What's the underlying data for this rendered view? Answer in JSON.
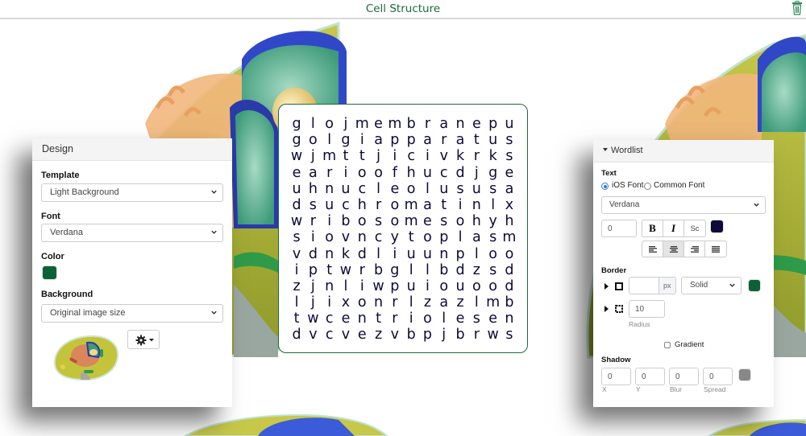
{
  "header": {
    "title": "Cell Structure",
    "trash_icon": "trash-icon",
    "title_color": "#1b6b3a"
  },
  "word_grid": {
    "rows": [
      "glojmembranepu",
      "golgiapparatus",
      "wjmttjicivkrks",
      "earioofhucdjge",
      "uhnucleolususa",
      "dsuchromatinlx",
      "wribosomesohyh",
      "siovncytoplasm",
      "vdnkdliuunploo",
      "iptwrbgllbdzsd",
      "zjnliwpuiouood",
      "ljixonrlzazlmb",
      "twcentriolesen",
      "dvcvezvbpjbrws"
    ],
    "letter_color": "#0c0a3a",
    "border_color": "#1b6b3a"
  },
  "design_panel": {
    "title": "Design",
    "template_label": "Template",
    "template_value": "Light Background",
    "font_label": "Font",
    "font_value": "Verdana",
    "color_label": "Color",
    "color_value": "#0b6236",
    "background_label": "Background",
    "background_value": "Original image size",
    "settings_icon": "gear-icon"
  },
  "wordlist_panel": {
    "title": "Wordlist",
    "text_label": "Text",
    "font_option_ios": "iOS Font",
    "font_option_common": "Common Font",
    "font_option_selected": "iOS Font",
    "font_value": "Verdana",
    "size_value": "0",
    "bold_label": "B",
    "italic_label": "I",
    "smallcaps_label": "Sc",
    "text_color": "#0c0a3a",
    "align_options": [
      "left",
      "center",
      "right",
      "justify"
    ],
    "align_selected": "center",
    "border_label": "Border",
    "border_width_value": "",
    "border_unit": "px",
    "border_style_value": "Solid",
    "border_color": "#0b6236",
    "radius_value": "10",
    "radius_label": "Radius",
    "gradient_label": "Gradient",
    "gradient_checked": false,
    "shadow_label": "Shadow",
    "shadow_x": "0",
    "shadow_y": "0",
    "shadow_blur": "0",
    "shadow_spread": "0",
    "shadow_x_label": "X",
    "shadow_y_label": "Y",
    "shadow_blur_label": "Blur",
    "shadow_spread_label": "Spread",
    "shadow_color": "#888888"
  }
}
